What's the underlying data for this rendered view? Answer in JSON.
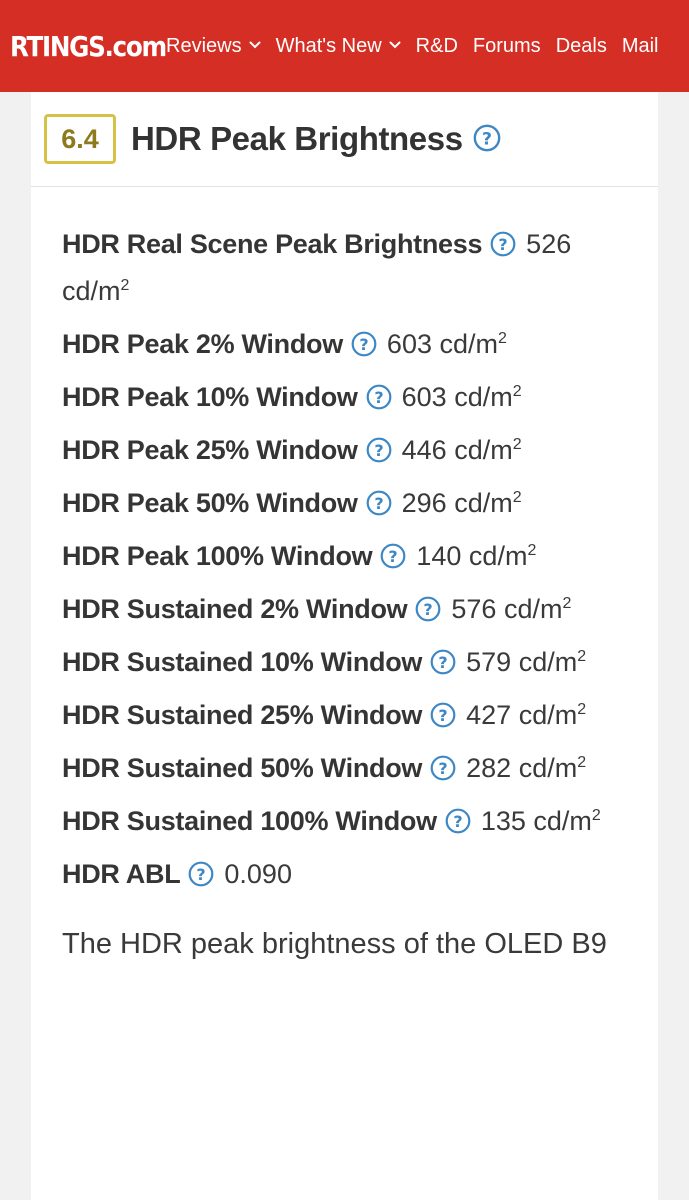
{
  "nav": {
    "logo": "RTINGS.com",
    "items": [
      {
        "label": "Reviews",
        "dropdown": true
      },
      {
        "label": "What's New",
        "dropdown": true
      },
      {
        "label": "R&D",
        "dropdown": false
      },
      {
        "label": "Forums",
        "dropdown": false
      },
      {
        "label": "Deals",
        "dropdown": false
      },
      {
        "label": "Mail",
        "dropdown": false
      }
    ]
  },
  "section": {
    "score": "6.4",
    "title": "HDR Peak Brightness"
  },
  "unit": {
    "base": "cd/m",
    "exp": "2"
  },
  "measurements": [
    {
      "label": "HDR Real Scene Peak Brightness",
      "value": "526"
    },
    {
      "label": "HDR Peak 2% Window",
      "value": "603"
    },
    {
      "label": "HDR Peak 10% Window",
      "value": "603"
    },
    {
      "label": "HDR Peak 25% Window",
      "value": "446"
    },
    {
      "label": "HDR Peak 50% Window",
      "value": "296"
    },
    {
      "label": "HDR Peak 100% Window",
      "value": "140"
    },
    {
      "label": "HDR Sustained 2% Window",
      "value": "576"
    },
    {
      "label": "HDR Sustained 10% Window",
      "value": "579"
    },
    {
      "label": "HDR Sustained 25% Window",
      "value": "427"
    },
    {
      "label": "HDR Sustained 50% Window",
      "value": "282"
    },
    {
      "label": "HDR Sustained 100% Window",
      "value": "135"
    }
  ],
  "abl": {
    "label": "HDR ABL",
    "value": "0.090"
  },
  "description": "The HDR peak brightness of the OLED B9",
  "colors": {
    "topbar": "#d42e25",
    "score_border": "#d6c248",
    "score_text": "#8c7a1c",
    "help_icon": "#3d87c4"
  }
}
